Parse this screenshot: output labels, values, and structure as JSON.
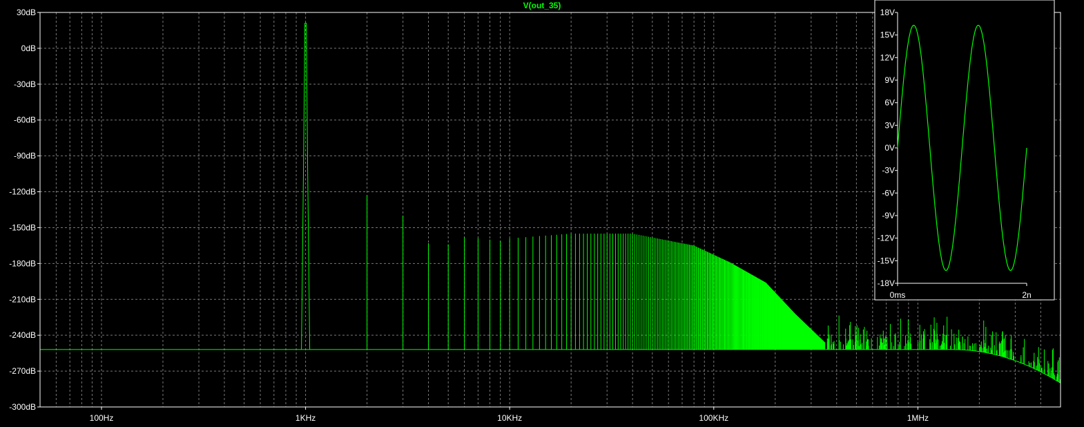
{
  "colors": {
    "background": "#000000",
    "frame": "#ffffff",
    "grid": "#7a7a7a",
    "trace": "#00ff00",
    "axis_text": "#ffffff"
  },
  "chart_data": [
    {
      "type": "line",
      "title": "V(out_35)",
      "xlabel": "",
      "ylabel": "",
      "x_scale": "log",
      "x_unit": "Hz",
      "xlim": [
        50,
        5000000
      ],
      "ylim": [
        -300,
        30
      ],
      "grid": true,
      "xtick_labels": [
        {
          "value": 100,
          "label": "100Hz"
        },
        {
          "value": 1000,
          "label": "1KHz"
        },
        {
          "value": 10000,
          "label": "10KHz"
        },
        {
          "value": 100000,
          "label": "100KHz"
        },
        {
          "value": 1000000,
          "label": "1MHz"
        }
      ],
      "ytick_labels": [
        {
          "value": 30,
          "label": "30dB"
        },
        {
          "value": 0,
          "label": "0dB"
        },
        {
          "value": -30,
          "label": "-30dB"
        },
        {
          "value": -60,
          "label": "-60dB"
        },
        {
          "value": -90,
          "label": "-90dB"
        },
        {
          "value": -120,
          "label": "-120dB"
        },
        {
          "value": -150,
          "label": "-150dB"
        },
        {
          "value": -180,
          "label": "-180dB"
        },
        {
          "value": -210,
          "label": "-210dB"
        },
        {
          "value": -240,
          "label": "-240dB"
        },
        {
          "value": -270,
          "label": "-270dB"
        },
        {
          "value": -300,
          "label": "-300dB"
        }
      ],
      "noise_floor_db": -252,
      "fundamental": {
        "freq": 1000,
        "db": 21
      },
      "harmonics": [
        {
          "freq": 2000,
          "db": -123
        },
        {
          "freq": 3000,
          "db": -140
        },
        {
          "freq": 4000,
          "db": -163
        },
        {
          "freq": 5000,
          "db": -164
        },
        {
          "freq": 6000,
          "db": -158
        },
        {
          "freq": 7000,
          "db": -159
        },
        {
          "freq": 8000,
          "db": -160
        },
        {
          "freq": 9000,
          "db": -161
        },
        {
          "freq": 10000,
          "db": -159
        },
        {
          "freq": 20000,
          "db": -155
        },
        {
          "freq": 40000,
          "db": -155
        },
        {
          "freq": 80000,
          "db": -165
        },
        {
          "freq": 120000,
          "db": -179
        },
        {
          "freq": 180000,
          "db": -196
        },
        {
          "freq": 250000,
          "db": -222
        },
        {
          "freq": 350000,
          "db": -246
        }
      ],
      "hf_rolloff_end": {
        "freq": 5000000,
        "db": -280
      }
    },
    {
      "type": "line",
      "title": "",
      "xlabel": "",
      "ylabel": "",
      "x_unit": "ms",
      "xlim": [
        0,
        2
      ],
      "ylim": [
        -18,
        18
      ],
      "grid": false,
      "amplitude_v": 16.3,
      "cycles": 2,
      "xtick_labels": [
        {
          "value": 0,
          "label": "0ms"
        },
        {
          "value": 2,
          "label": "2n"
        }
      ],
      "ytick_labels": [
        {
          "value": 18,
          "label": "18V"
        },
        {
          "value": 15,
          "label": "15V"
        },
        {
          "value": 12,
          "label": "12V"
        },
        {
          "value": 9,
          "label": "9V"
        },
        {
          "value": 6,
          "label": "6V"
        },
        {
          "value": 3,
          "label": "3V"
        },
        {
          "value": 0,
          "label": "0V"
        },
        {
          "value": -3,
          "label": "-3V"
        },
        {
          "value": -6,
          "label": "-6V"
        },
        {
          "value": -9,
          "label": "-9V"
        },
        {
          "value": -12,
          "label": "-12V"
        },
        {
          "value": -15,
          "label": "-15V"
        },
        {
          "value": -18,
          "label": "-18V"
        }
      ]
    }
  ]
}
